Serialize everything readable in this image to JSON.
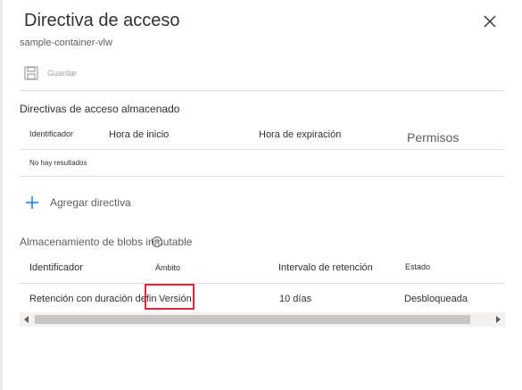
{
  "panel": {
    "title": "Directiva de acceso",
    "subtitle": "sample-container-vlw"
  },
  "toolbar": {
    "save_label": "Guardar",
    "save_icon": "floppy-disk-icon",
    "close_icon": "close-icon"
  },
  "stored_policies": {
    "title": "Directivas de acceso almacenado",
    "columns": [
      "Identificador",
      "Hora de inicio",
      "Hora de expiración",
      "Permisos"
    ],
    "empty_text": "No hay resultados",
    "add_label": "Agregar directiva",
    "add_icon": "plus-icon"
  },
  "immutable": {
    "title": "Almacenamiento de blobs inmutable",
    "info_icon": "info-icon",
    "columns": [
      "Identificador",
      "Ámbito",
      "Intervalo de retención",
      "Estado"
    ],
    "rows": [
      [
        "Retención con duración definida",
        "Versión",
        "10 días",
        "Desbloqueada"
      ]
    ]
  },
  "colors": {
    "accent": "#0078d4",
    "highlight_border": "#d6283a"
  }
}
